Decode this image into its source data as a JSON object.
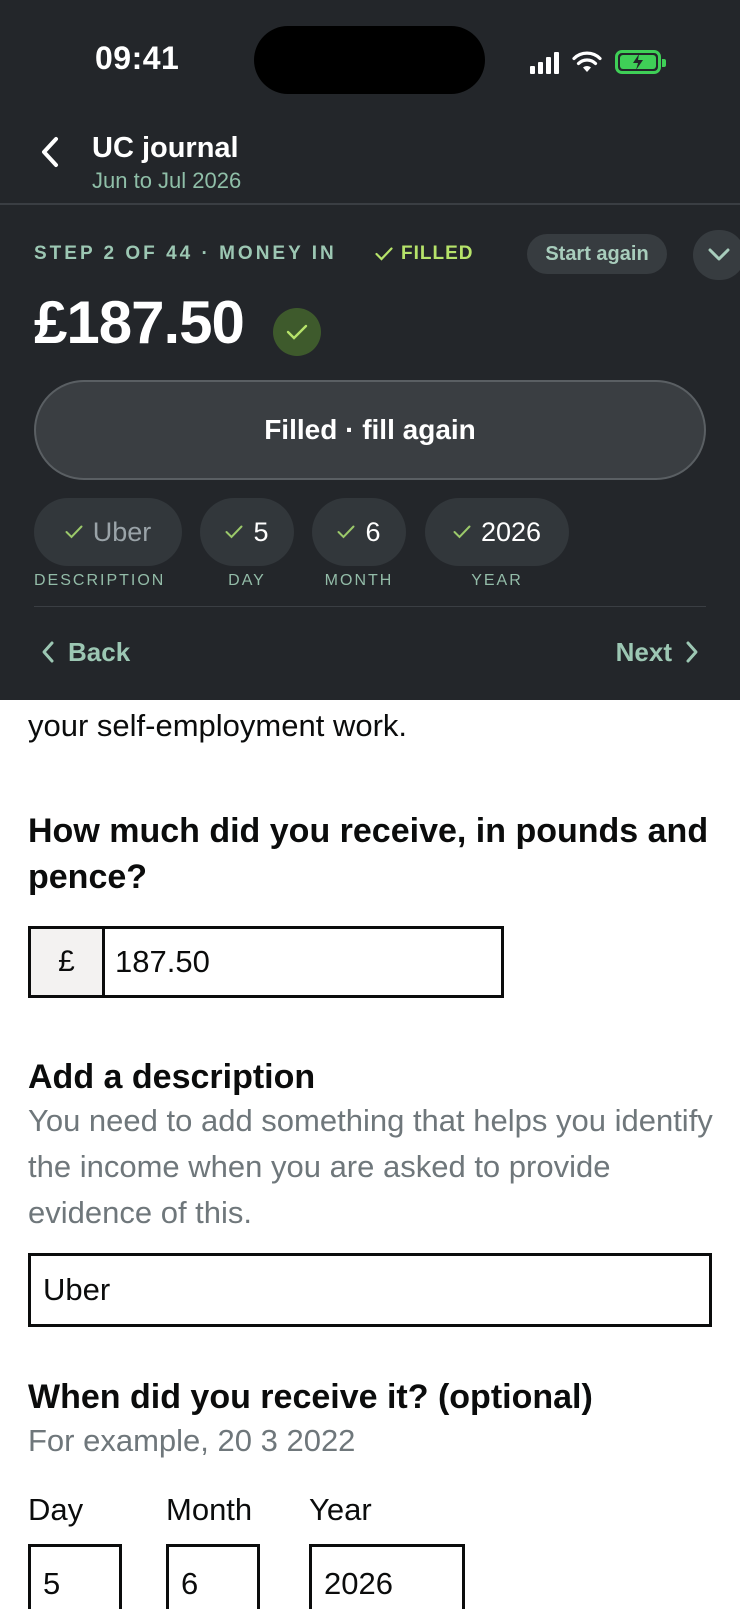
{
  "status_bar": {
    "time": "09:41"
  },
  "nav": {
    "title": "UC journal",
    "subtitle": "Jun to Jul 2026"
  },
  "step": {
    "label": "STEP 2 OF 44 · MONEY IN",
    "filled_label": "FILLED",
    "start_again_label": "Start again"
  },
  "summary": {
    "amount": "£187.50"
  },
  "fill_again_label": "Filled · fill again",
  "chips": [
    {
      "value": "Uber",
      "label": "DESCRIPTION"
    },
    {
      "value": "5",
      "label": "DAY"
    },
    {
      "value": "6",
      "label": "MONTH"
    },
    {
      "value": "2026",
      "label": "YEAR"
    }
  ],
  "pager": {
    "back_label": "Back",
    "next_label": "Next"
  },
  "form": {
    "intro_tail": "your self-employment work.",
    "amount_question": "How much did you receive, in pounds and pence?",
    "currency_prefix": "£",
    "amount_value": "187.50",
    "description_heading": "Add a description",
    "description_hint": "You need to add something that helps you identify the income when you are asked to provide evidence of this.",
    "description_value": "Uber",
    "date_question": "When did you receive it? (optional)",
    "date_hint": "For example, 20 3 2022",
    "day_label": "Day",
    "month_label": "Month",
    "year_label": "Year",
    "day_value": "5",
    "month_value": "6",
    "year_value": "2026"
  },
  "colors": {
    "panel_bg": "#23262a",
    "accent_green": "#9cc7b3",
    "filled_green": "#b6e36a",
    "battery_green": "#3fcf57"
  },
  "icons": [
    "back-chevron-icon",
    "signal-icon",
    "wifi-icon",
    "battery-icon",
    "check-icon",
    "chevron-down-icon",
    "chevron-left-icon",
    "chevron-right-icon"
  ]
}
